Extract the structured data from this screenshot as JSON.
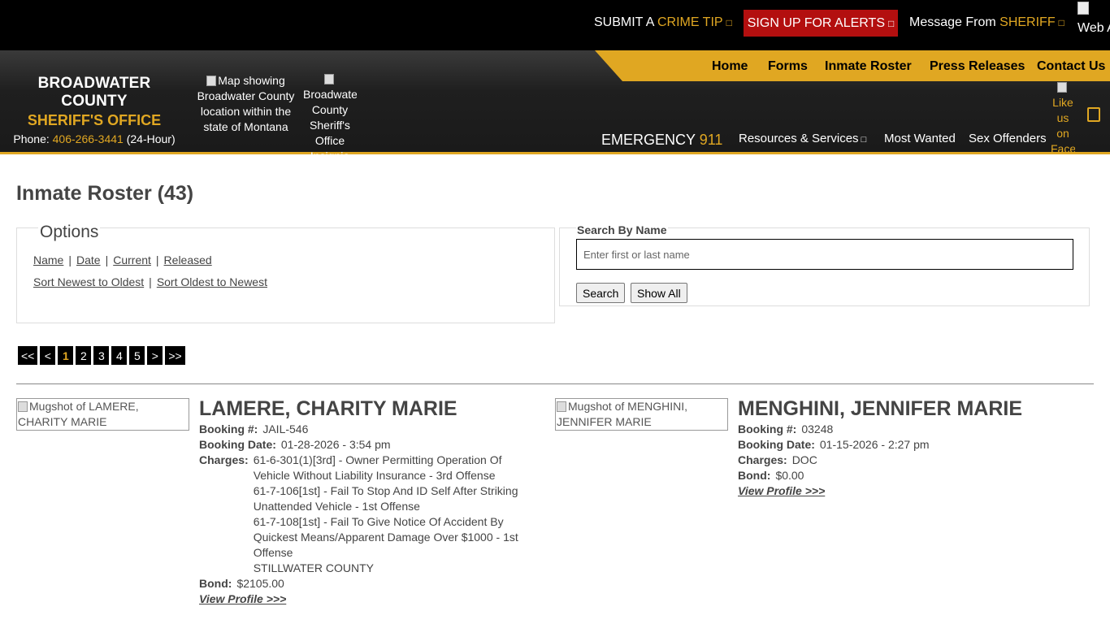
{
  "topbar": {
    "crime_tip_prefix": "SUBMIT A ",
    "crime_tip_highlight": "CRIME TIP",
    "alerts_label": "SIGN UP FOR ALERTS",
    "message_prefix": "Message From ",
    "message_highlight": "SHERIFF",
    "accessibility_alt": "Web Accessibility",
    "glyph": "□"
  },
  "brand": {
    "line1": "BROADWATER COUNTY",
    "line2": "SHERIFF'S OFFICE",
    "phone_prefix": "Phone: ",
    "phone_number": "406-266-3441",
    "phone_suffix": " (24-Hour)"
  },
  "header_images": {
    "map_alt": "Map showing Broadwater County location within the state of Montana",
    "insignia_alt": "Broadwater County Sheriff's Office Insignia",
    "facebook_alt": "Like us on Facebook"
  },
  "main_nav": [
    "Home",
    "Forms",
    "Inmate Roster",
    "Press Releases",
    "Contact Us"
  ],
  "emergency": {
    "label": "EMERGENCY ",
    "number": "911"
  },
  "sub_nav": {
    "resources": "Resources & Services",
    "most_wanted": "Most Wanted",
    "sex_offenders": "Sex Offenders",
    "glyph": "□"
  },
  "page": {
    "title": "Inmate Roster (43)"
  },
  "options": {
    "legend": "Options",
    "filters": [
      "Name",
      "Date",
      "Current",
      "Released"
    ],
    "sorts": [
      "Sort Newest to Oldest",
      "Sort Oldest to Newest"
    ],
    "separator": "|"
  },
  "search": {
    "label": "Search By Name",
    "placeholder": "Enter first or last name",
    "search_button": "Search",
    "show_all_button": "Show All"
  },
  "pagination": {
    "first": "<<",
    "prev": "<",
    "pages": [
      "1",
      "2",
      "3",
      "4",
      "5"
    ],
    "next": ">",
    "last": ">>",
    "current": "1"
  },
  "inmates": [
    {
      "mugshot_alt": "Mugshot of LAMERE, CHARITY MARIE",
      "name": "LAMERE, CHARITY MARIE",
      "booking_label": "Booking #:",
      "booking": "JAIL-546",
      "date_label": "Booking Date:",
      "date": "01-28-2026 - 3:54 pm",
      "charges_label": "Charges:",
      "charges": [
        "61-6-301(1)[3rd] - Owner Permitting Operation Of Vehicle Without Liability Insurance - 3rd Offense",
        "61-7-106[1st] - Fail To Stop And ID Self After Striking Unattended Vehicle - 1st Offense",
        "61-7-108[1st] - Fail To Give Notice Of Accident By Quickest Means/Apparent Damage Over $1000 - 1st Offense",
        "STILLWATER COUNTY"
      ],
      "bond_label": "Bond:",
      "bond": "$2105.00",
      "view": "View Profile >>>"
    },
    {
      "mugshot_alt": "Mugshot of MENGHINI, JENNIFER MARIE",
      "name": "MENGHINI, JENNIFER MARIE",
      "booking_label": "Booking #:",
      "booking": "03248",
      "date_label": "Booking Date:",
      "date": "01-15-2026 - 2:27 pm",
      "charges_label": "Charges:",
      "charges": [
        "DOC"
      ],
      "bond_label": "Bond:",
      "bond": "$0.00",
      "view": "View Profile >>>"
    }
  ],
  "colors": {
    "accent": "#e0a722",
    "alert_red": "#b30f0f",
    "topbar": "#000000"
  }
}
